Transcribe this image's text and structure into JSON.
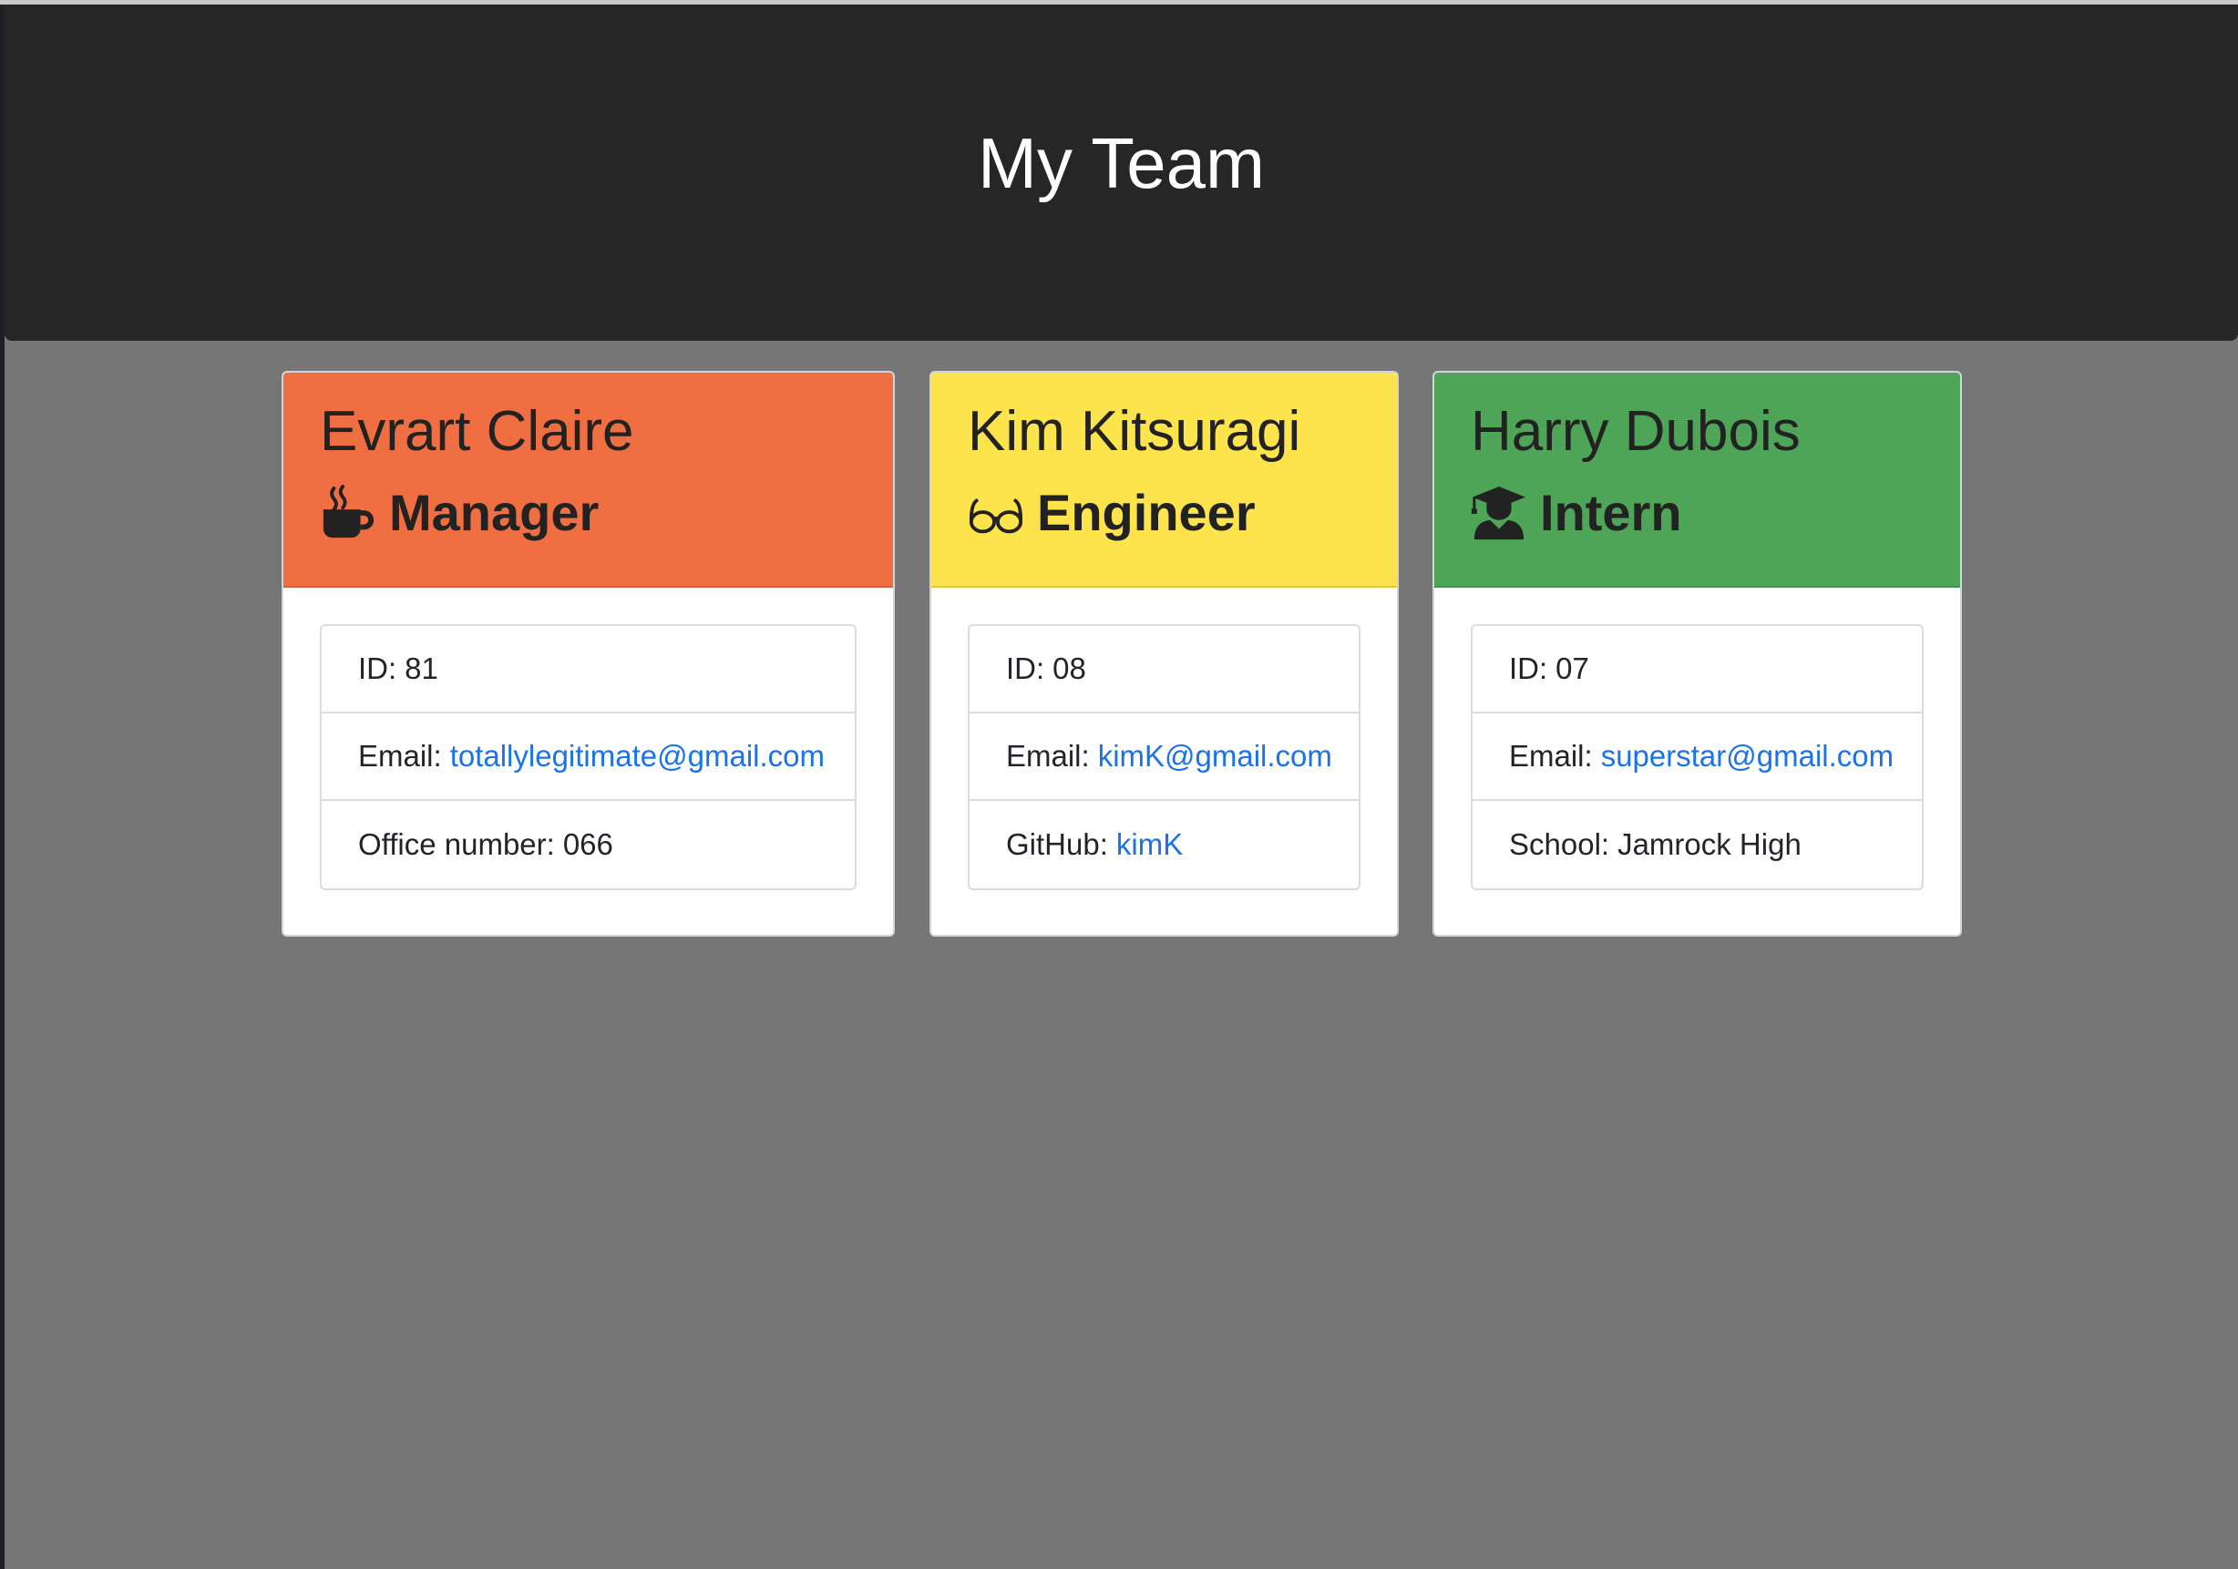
{
  "page": {
    "title": "My Team"
  },
  "employees": [
    {
      "name": "Evrart Claire",
      "role": "Manager",
      "icon": "mug-hot-icon",
      "header_color": "#f06f42",
      "id_label": "ID:",
      "id": "81",
      "email_label": "Email:",
      "email": "totallylegitimate@gmail.com",
      "extra_label": "Office number:",
      "extra_value": "066"
    },
    {
      "name": "Kim Kitsuragi",
      "role": "Engineer",
      "icon": "glasses-icon",
      "header_color": "#fde34c",
      "id_label": "ID:",
      "id": "08",
      "email_label": "Email:",
      "email": "kimK@gmail.com",
      "extra_label": "GitHub:",
      "extra_value": "kimK"
    },
    {
      "name": "Harry Dubois",
      "role": "Intern",
      "icon": "graduate-icon",
      "header_color": "#4ea558",
      "id_label": "ID:",
      "id": "07",
      "email_label": "Email:",
      "email": "superstar@gmail.com",
      "extra_label": "School:",
      "extra_value": "Jamrock High"
    }
  ],
  "colors": {
    "page_background": "#767676",
    "jumbotron": "#262626",
    "link": "#1a73e8"
  }
}
